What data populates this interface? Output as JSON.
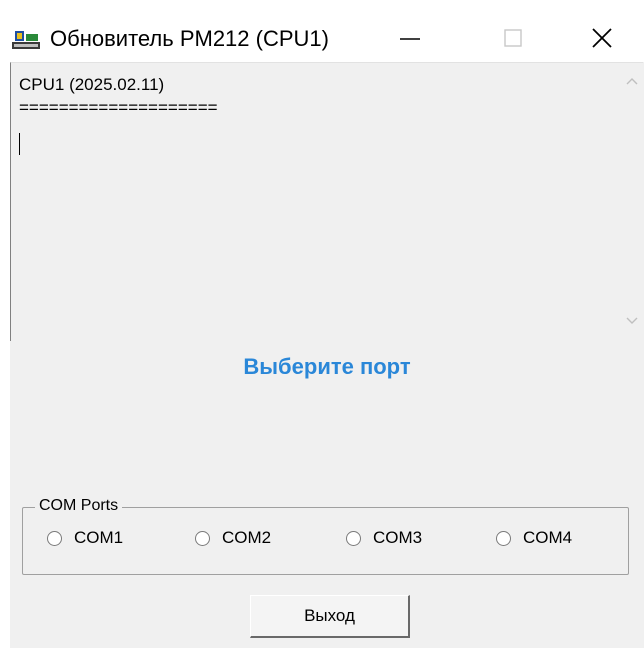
{
  "window": {
    "title": "Обновитель PM212 (CPU1)",
    "icon": "app-icon",
    "controls": [
      "minimize-icon",
      "maximize-icon",
      "close-icon"
    ]
  },
  "log": {
    "line1": "CPU1 (2025.02.11)",
    "line2": "===================="
  },
  "status": {
    "text": "Выберите порт",
    "color": "#2a87d8"
  },
  "com_ports": {
    "label": "COM Ports",
    "options": [
      "COM1",
      "COM2",
      "COM3",
      "COM4"
    ],
    "selected": null
  },
  "exit_button": {
    "label": "Выход"
  }
}
